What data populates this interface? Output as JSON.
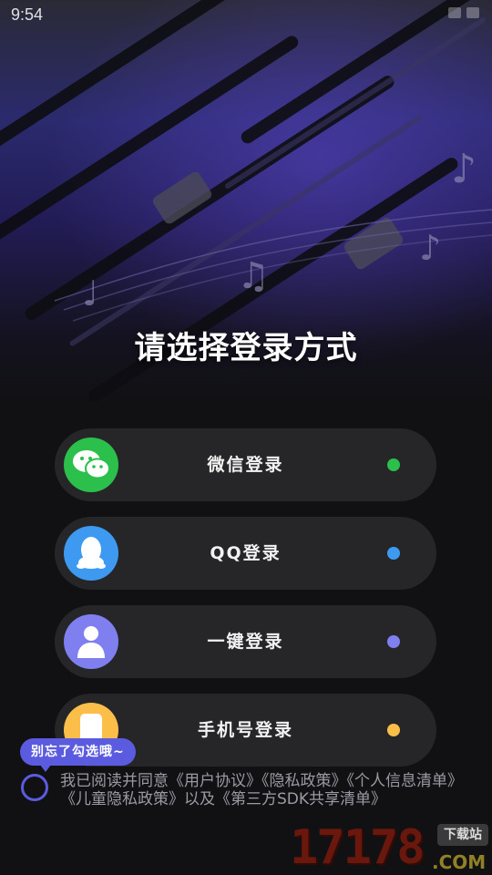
{
  "status_bar": {
    "time": "9:54"
  },
  "page_title": "请选择登录方式",
  "login_options": [
    {
      "label": "微信登录",
      "icon": "wechat-icon",
      "icon_color": "#2bbf4b",
      "dot_color": "#2bbf4b"
    },
    {
      "label": "QQ登录",
      "icon": "qq-penguin-icon",
      "icon_color": "#3d9af0",
      "dot_color": "#3d9af0"
    },
    {
      "label": "一键登录",
      "icon": "user-icon",
      "icon_color": "#7f7ff0",
      "dot_color": "#7f7ff0"
    },
    {
      "label": "手机号登录",
      "icon": "phone-icon",
      "icon_color": "#fbbe48",
      "dot_color": "#fbbe48"
    }
  ],
  "agreement": {
    "tooltip": "别忘了勾选哦~",
    "text": "我已阅读并同意《用户协议》《隐私政策》《个人信息清单》《儿童隐私政策》以及《第三方SDK共享清单》"
  },
  "watermark": {
    "number": "17178",
    "domain": ".COM",
    "tag": "下载站"
  }
}
